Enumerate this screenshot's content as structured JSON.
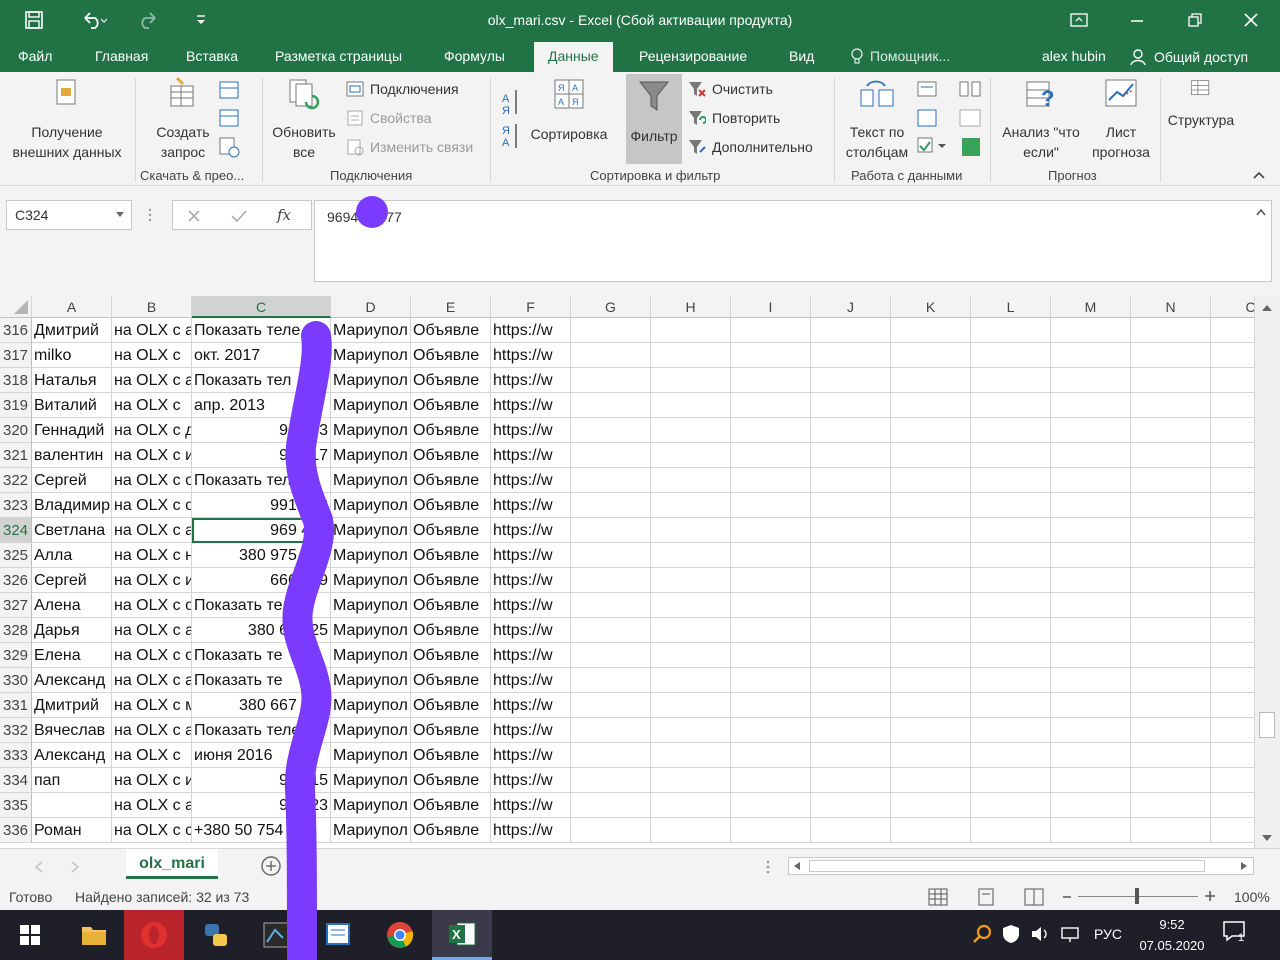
{
  "window": {
    "title": "olx_mari.csv - Excel (Сбой активации продукта)"
  },
  "menu": {
    "tabs": [
      "Файл",
      "Главная",
      "Вставка",
      "Разметка страницы",
      "Формулы",
      "Данные",
      "Рецензирование",
      "Вид"
    ],
    "active_tab": "Данные",
    "tell_me": "Помощник...",
    "user": "alex hubin",
    "share": "Общий доступ"
  },
  "ribbon": {
    "get_external": "Получение внешних данных",
    "new_query": "Создать запрос",
    "group_transform": "Скачать & прео...",
    "refresh_all": "Обновить все",
    "connections": "Подключения",
    "properties": "Свойства",
    "edit_links": "Изменить связи",
    "group_connections": "Подключения",
    "sort": "Сортировка",
    "filter": "Фильтр",
    "clear": "Очистить",
    "reapply": "Повторить",
    "advanced": "Дополнительно",
    "group_sort": "Сортировка и фильтр",
    "text_to_columns": "Текст по столбцам",
    "group_data_tools": "Работа с данными",
    "whatif": "Анализ \"что если\"",
    "forecast_sheet": "Лист прогноза",
    "group_forecast": "Прогноз",
    "outline": "Структура"
  },
  "formula_bar": {
    "name_box": "C324",
    "formula": "969424677",
    "formula_visible_left": "9694",
    "formula_visible_right": "77",
    "fx": "fx"
  },
  "grid": {
    "columns": [
      "A",
      "B",
      "C",
      "D",
      "E",
      "F",
      "G",
      "H",
      "I",
      "J",
      "K",
      "L",
      "M",
      "N",
      "C"
    ],
    "selected_column": "C",
    "selected_row": "324",
    "rows": [
      {
        "n": "316",
        "a": "Дмитрий",
        "b": "на OLX с а",
        "c": "Показать теле",
        "c_num": false,
        "d": "Мариупол",
        "e": "Объявле",
        "f": "https://w"
      },
      {
        "n": "317",
        "a": "milko",
        "b": "на OLX с",
        "c": "окт. 2017",
        "c_num": false,
        "d": "Мариупол",
        "e": "Объявле",
        "f": "https://w"
      },
      {
        "n": "318",
        "a": "Наталья",
        "b": "на OLX с а",
        "c": "Показать тел",
        "c_num": false,
        "d": "Мариупол",
        "e": "Объявле",
        "f": "https://w"
      },
      {
        "n": "319",
        "a": "Виталий",
        "b": "на OLX с",
        "c": "апр. 2013",
        "c_num": false,
        "d": "Мариупол",
        "e": "Объявле",
        "f": "https://w"
      },
      {
        "n": "320",
        "a": "Геннадий",
        "b": "на OLX с д",
        "c": "962 63",
        "c_num": true,
        "d": "Мариупол",
        "e": "Объявле",
        "f": "https://w"
      },
      {
        "n": "321",
        "a": "валентин",
        "b": "на OLX с и",
        "c": "976 17",
        "c_num": true,
        "d": "Мариупол",
        "e": "Объявле",
        "f": "https://w"
      },
      {
        "n": "322",
        "a": "Сергей",
        "b": "на OLX с о",
        "c": "Показать тел",
        "c_num": false,
        "d": "Мариупол",
        "e": "Объявле",
        "f": "https://w"
      },
      {
        "n": "323",
        "a": "Владимир",
        "b": "на OLX с о",
        "c": "991 248",
        "c_num": true,
        "d": "Мариупол",
        "e": "Объявле",
        "f": "https://w"
      },
      {
        "n": "324",
        "a": "Светлана",
        "b": "на OLX с а",
        "c": "969 424",
        "c_num": true,
        "d": "Мариупол",
        "e": "Объявле",
        "f": "https://w"
      },
      {
        "n": "325",
        "a": "Алла",
        "b": "на OLX с н",
        "c": "380 975 543",
        "c_num": true,
        "d": "Мариупол",
        "e": "Объявле",
        "f": "https://w"
      },
      {
        "n": "326",
        "a": "Сергей",
        "b": "на OLX с и",
        "c": "666 779",
        "c_num": true,
        "d": "Мариупол",
        "e": "Объявле",
        "f": "https://w"
      },
      {
        "n": "327",
        "a": "Алена",
        "b": "на OLX с о",
        "c": "Показать те",
        "c_num": false,
        "d": "Мариупол",
        "e": "Объявле",
        "f": "https://w"
      },
      {
        "n": "328",
        "a": "Дарья",
        "b": "на OLX с а",
        "c": "380 674 25",
        "c_num": true,
        "d": "Мариупол",
        "e": "Объявле",
        "f": "https://w"
      },
      {
        "n": "329",
        "a": "Елена",
        "b": "на OLX с о",
        "c": "Показать те",
        "c_num": false,
        "d": "Мариупол",
        "e": "Объявле",
        "f": "https://w"
      },
      {
        "n": "330",
        "a": "Александ",
        "b": "на OLX с а",
        "c": "Показать те",
        "c_num": false,
        "d": "Мариупол",
        "e": "Объявле",
        "f": "https://w"
      },
      {
        "n": "331",
        "a": "Дмитрий",
        "b": "на OLX с м",
        "c": "380 667 728",
        "c_num": true,
        "d": "Мариупол",
        "e": "Объявле",
        "f": "https://w"
      },
      {
        "n": "332",
        "a": "Вячеслав",
        "b": "на OLX с а",
        "c": "Показать теле",
        "c_num": false,
        "d": "Мариупол",
        "e": "Объявле",
        "f": "https://w"
      },
      {
        "n": "333",
        "a": "Александ",
        "b": "на OLX с",
        "c": "июня 2016",
        "c_num": false,
        "d": "Мариупол",
        "e": "Объявле",
        "f": "https://w"
      },
      {
        "n": "334",
        "a": "пап",
        "b": "на OLX с и",
        "c": "977 15",
        "c_num": true,
        "d": "Мариупол",
        "e": "Объявле",
        "f": "https://w"
      },
      {
        "n": "335",
        "a": "",
        "b": "на OLX с а",
        "c": "972 23",
        "c_num": true,
        "d": "Мариупол",
        "e": "Объявле",
        "f": "https://w"
      },
      {
        "n": "336",
        "a": "Роман",
        "b": "на OLX с с",
        "c": "+380 50 754 1",
        "c_num": false,
        "d": "Мариупол",
        "e": "Объявле",
        "f": "https://w"
      }
    ]
  },
  "sheets": {
    "active": "olx_mari",
    "add_icon": "plus-circle-icon"
  },
  "status": {
    "ready": "Готово",
    "records": "Найдено записей: 32 из 73",
    "zoom": "100%"
  },
  "taskbar": {
    "time": "9:52",
    "date": "07.05.2020",
    "lang": "РУС",
    "notifications": "1"
  },
  "colors": {
    "excel_green": "#217346",
    "annotation_purple": "#7b3bff"
  }
}
